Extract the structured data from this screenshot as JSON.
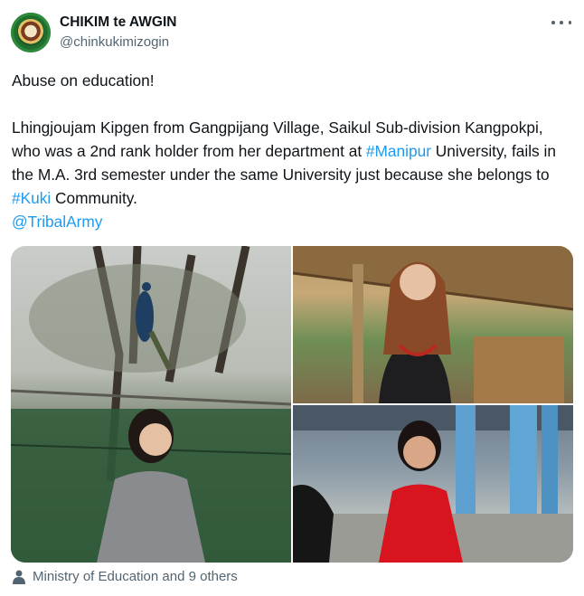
{
  "author": {
    "name": "CHIKIM te AWGIN",
    "handle": "@chinkukimizogin"
  },
  "tweet": {
    "line1": "Abuse on education!",
    "p2_part1": "Lhingjoujam Kipgen from Gangpijang Village, Saikul Sub-division Kangpokpi, who was a 2nd rank holder from her department at ",
    "hashtag_manipur": "#Manipur",
    "p2_part2": " University, fails in the M.A. 3rd semester under the same University just because she belongs to ",
    "hashtag_kuki": "#Kuki",
    "p2_part3": " Community.",
    "mention": "@TribalArmy"
  },
  "media": {
    "images": [
      {
        "description": "woman in grey sweater before a fence with a peacock on a tree"
      },
      {
        "description": "woman in black top with red necklace by a thatched hut"
      },
      {
        "description": "woman in red dress in a covered corridor"
      }
    ]
  },
  "likes": {
    "text": "Ministry of Education and 9 others"
  },
  "colors": {
    "link": "#1d9bf0",
    "secondary": "#536471",
    "text": "#0f1419"
  }
}
